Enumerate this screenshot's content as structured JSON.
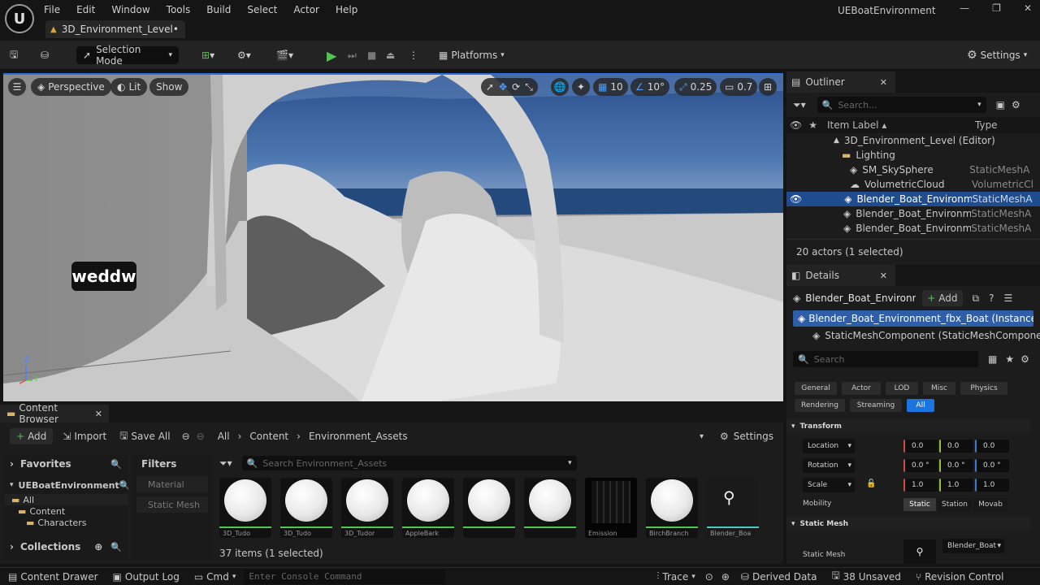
{
  "menu": [
    "File",
    "Edit",
    "Window",
    "Tools",
    "Build",
    "Select",
    "Actor",
    "Help"
  ],
  "project_name": "UEBoatEnvironment",
  "level_tab": "3D_Environment_Level•",
  "toolbar": {
    "selection_mode": "Selection Mode",
    "platforms": "Platforms",
    "settings": "Settings"
  },
  "viewport": {
    "perspective": "Perspective",
    "lit": "Lit",
    "show": "Show",
    "grid_snap": "10",
    "rotation_snap": "10°",
    "scale_snap": "0.25",
    "camera_speed": "0.7",
    "overlay_text": "weddw",
    "axis_z": "Z",
    "axis_y": "Y"
  },
  "outliner": {
    "title": "Outliner",
    "search_placeholder": "Search...",
    "col_label": "Item Label ▴",
    "col_type": "Type",
    "rows": [
      {
        "label": "3D_Environment_Level (Editor)",
        "type": ""
      },
      {
        "label": "Lighting",
        "type": ""
      },
      {
        "label": "SM_SkySphere",
        "type": "StaticMeshA"
      },
      {
        "label": "VolumetricCloud",
        "type": "VolumetricCl"
      },
      {
        "label": "Blender_Boat_Environmen",
        "type": "StaticMeshA"
      },
      {
        "label": "Blender_Boat_Environmen",
        "type": "StaticMeshA"
      },
      {
        "label": "Blender_Boat_Environmen",
        "type": "StaticMeshA"
      }
    ],
    "status": "20 actors (1 selected)"
  },
  "details": {
    "title": "Details",
    "actor_name": "Blender_Boat_Environme",
    "add": "Add",
    "instance": "Blender_Boat_Environment_fbx_Boat (Instance)",
    "component": "StaticMeshComponent (StaticMeshComponen",
    "search_placeholder": "Search",
    "filters_row1": [
      "General",
      "Actor",
      "LOD",
      "Misc",
      "Physics"
    ],
    "filters_row2": [
      "Rendering",
      "Streaming",
      "All"
    ],
    "transform_header": "Transform",
    "location": {
      "label": "Location",
      "x": "0.0",
      "y": "0.0",
      "z": "0.0"
    },
    "rotation": {
      "label": "Rotation",
      "x": "0.0 °",
      "y": "0.0 °",
      "z": "0.0 °"
    },
    "scale": {
      "label": "Scale",
      "x": "1.0",
      "y": "1.0",
      "z": "1.0"
    },
    "mobility": {
      "label": "Mobility",
      "options": [
        "Static",
        "Station",
        "Movab"
      ]
    },
    "static_mesh_header": "Static Mesh",
    "static_mesh_label": "Static Mesh",
    "static_mesh_value": "Blender_Boat"
  },
  "content_browser": {
    "title": "Content Browser",
    "add": "Add",
    "import": "Import",
    "save_all": "Save All",
    "path": [
      "All",
      "Content",
      "Environment_Assets"
    ],
    "settings": "Settings",
    "favorites": "Favorites",
    "project": "UEBoatEnvironment",
    "tree": [
      "All",
      "Content",
      "Characters"
    ],
    "collections": "Collections",
    "filters_title": "Filters",
    "filters": [
      "Material",
      "Static Mesh"
    ],
    "search_placeholder": "Search Environment_Assets",
    "assets": [
      "3D_Tudo",
      "3D_Tudo",
      "3D_Tudor",
      "AppleBark",
      "",
      "",
      "Emission",
      "BirchBranch",
      "Blender_Boa"
    ],
    "items_status": "37 items (1 selected)"
  },
  "statusbar": {
    "content_drawer": "Content Drawer",
    "output_log": "Output Log",
    "cmd": "Cmd",
    "console_placeholder": "Enter Console Command",
    "trace": "Trace",
    "derived_data": "Derived Data",
    "unsaved": "38 Unsaved",
    "revision": "Revision Control"
  }
}
